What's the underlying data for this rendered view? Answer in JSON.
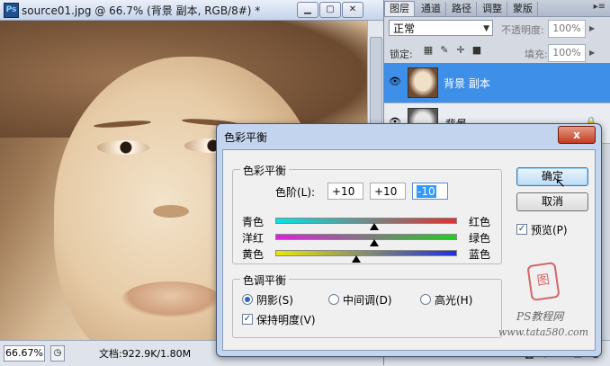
{
  "document": {
    "title": "source01.jpg @ 66.7% (背景 副本, RGB/8#) *",
    "zoom": "66.67%",
    "doc_info": "文档:922.9K/1.80M"
  },
  "layers_panel": {
    "tabs": [
      "图层",
      "通道",
      "路径",
      "调整",
      "蒙版"
    ],
    "active_tab": 0,
    "blend_mode": "正常",
    "opacity_label": "不透明度:",
    "opacity_value": "100%",
    "lock_label": "锁定:",
    "fill_label": "填充:",
    "fill_value": "100%",
    "layers": [
      {
        "name": "背景 副本",
        "selected": true
      },
      {
        "name": "背景",
        "selected": false,
        "locked": true
      }
    ]
  },
  "dialog": {
    "title": "色彩平衡",
    "close_label": "x",
    "color_balance": {
      "legend": "色彩平衡",
      "levels_label": "色阶(L):",
      "levels": [
        "+10",
        "+10",
        "-10"
      ],
      "sliders": [
        {
          "left": "青色",
          "right": "红色",
          "value": 10
        },
        {
          "left": "洋红",
          "right": "绿色",
          "value": 10
        },
        {
          "left": "黄色",
          "right": "蓝色",
          "value": -10
        }
      ]
    },
    "tone_balance": {
      "legend": "色调平衡",
      "options": [
        "阴影(S)",
        "中间调(D)",
        "高光(H)"
      ],
      "selected": 0,
      "preserve_luminosity": "保持明度(V)"
    },
    "buttons": {
      "ok": "确定",
      "cancel": "取消",
      "preview": "预览(P)"
    },
    "watermark": {
      "line1": "PS教程网",
      "line2": "www.tata580.com"
    }
  }
}
